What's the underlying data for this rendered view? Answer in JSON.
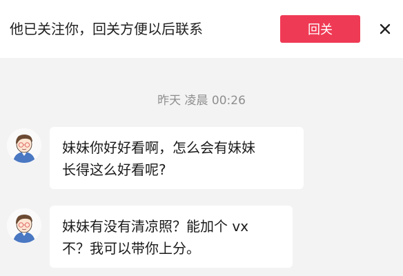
{
  "banner": {
    "text": "他已关注你，回关方便以后联系",
    "follow_back_label": "回关",
    "accent_color": "#ef3a55"
  },
  "chat": {
    "timestamp": "昨天 凌晨 00:26",
    "messages": [
      {
        "lines": [
          "妹妹你好好看啊，怎么会有妹妹",
          "长得这么好看呢?"
        ]
      },
      {
        "lines": [
          "妹妹有没有清凉照？能加个 vx",
          "不？我可以带你上分。"
        ]
      }
    ]
  }
}
